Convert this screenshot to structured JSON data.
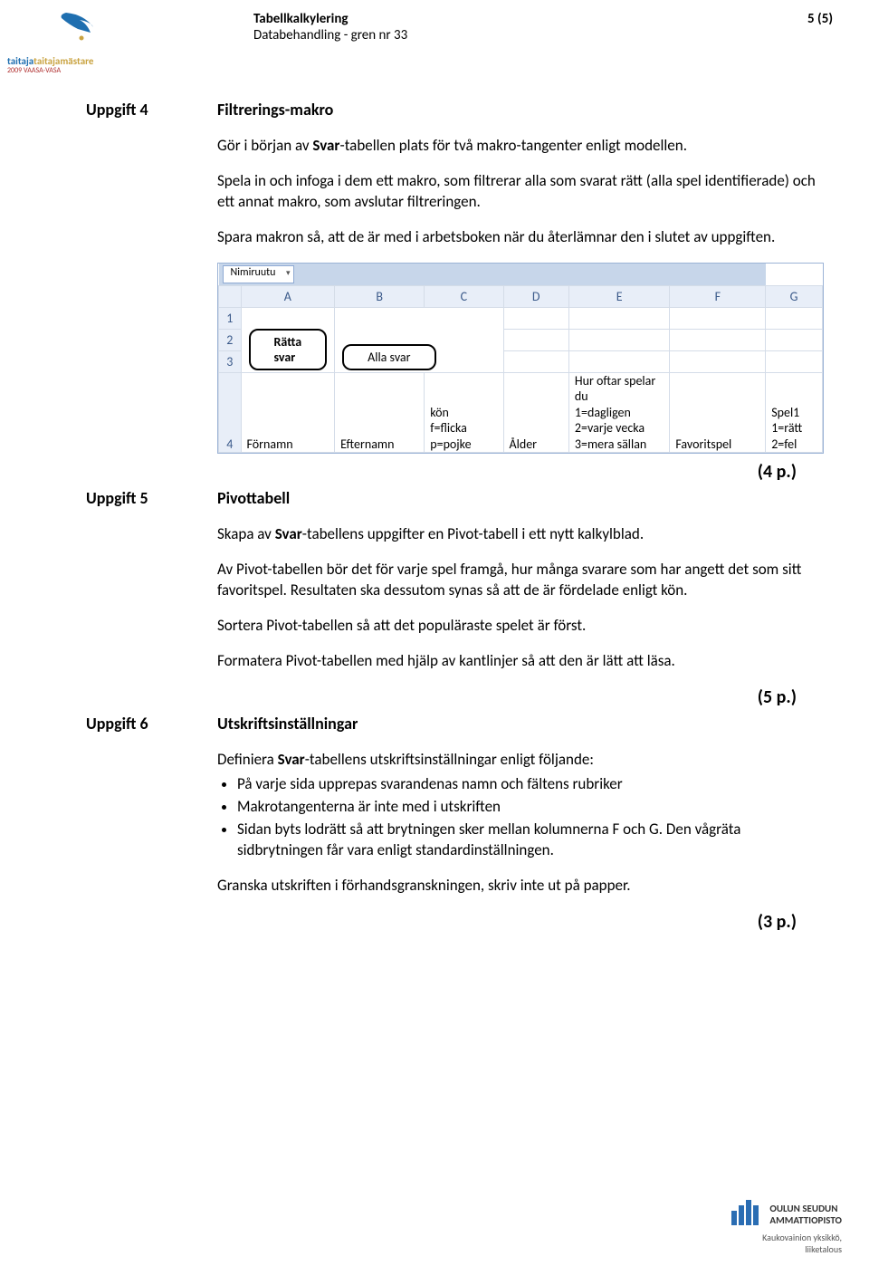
{
  "header": {
    "title": "Tabellkalkylering",
    "subtitle": "Databehandling - gren nr 33",
    "page": "5 (5)",
    "logo_top": "taitajamästare",
    "logo_year": "2009 VAASA-VASA"
  },
  "tasks": {
    "t4": {
      "label": "Uppgift 4",
      "title": "Filtrerings-makro",
      "p1a": "Gör i början av ",
      "p1b": "Svar",
      "p1c": "-tabellen plats för två makro-tangenter enligt modellen.",
      "p2": "Spela in och infoga i dem ett makro, som filtrerar alla som svarat rätt (alla spel identifierade) och ett annat makro, som avslutar filtreringen.",
      "p3": "Spara makron så, att de är med i arbetsboken när du återlämnar den i slutet av uppgiften.",
      "points": "(4 p.)"
    },
    "t5": {
      "label": "Uppgift 5",
      "title": "Pivottabell",
      "p1a": "Skapa av ",
      "p1b": "Svar",
      "p1c": "-tabellens uppgifter en Pivot-tabell i ett nytt kalkylblad.",
      "p2": "Av Pivot-tabellen bör det för varje spel framgå, hur många svarare som har angett det som sitt favoritspel. Resultaten ska dessutom synas så att de är fördelade enligt kön.",
      "p3": "Sortera Pivot-tabellen så att det populäraste spelet är först.",
      "p4": "Formatera Pivot-tabellen med hjälp av kantlinjer så att den är lätt att läsa.",
      "points": "(5 p.)"
    },
    "t6": {
      "label": "Uppgift 6",
      "title": "Utskriftsinställningar",
      "p1a": "Definiera ",
      "p1b": "Svar",
      "p1c": "-tabellens utskriftsinställningar enligt följande:",
      "b1": "På varje sida upprepas svarandenas namn och fältens rubriker",
      "b2": "Makrotangenterna är inte med i utskriften",
      "b3": "Sidan byts lodrätt så att brytningen sker mellan kolumnerna F och G. Den vågräta sidbrytningen får vara enligt standardinställningen.",
      "p2": "Granska utskriften i förhandsgranskningen, skriv inte ut på papper.",
      "points": "(3 p.)"
    }
  },
  "sheet": {
    "namebox": "Nimiruutu",
    "cols": {
      "b": "B",
      "c": "C",
      "d": "D",
      "e": "E",
      "f": "F",
      "g": "G"
    },
    "rows": {
      "r1": "1",
      "r2": "2",
      "r3": "3",
      "r4": "4"
    },
    "btn1": "Rätta svar",
    "btn2": "Alla svar",
    "r4": {
      "a": "Förnamn",
      "b": "Efternamn",
      "c": "kön\nf=flicka\np=pojke",
      "d": "Ålder",
      "e": "Hur oftar spelar\ndu\n1=dagligen\n2=varje vecka\n3=mera sällan",
      "f": "Favoritspel",
      "g": "Spel1\n1=rätt\n2=fel"
    }
  },
  "footer": {
    "org1": "OULUN SEUDUN",
    "org2": "AMMATTIOPISTO",
    "sub1": "Kaukovainion yksikkö,",
    "sub2": "liiketalous"
  }
}
